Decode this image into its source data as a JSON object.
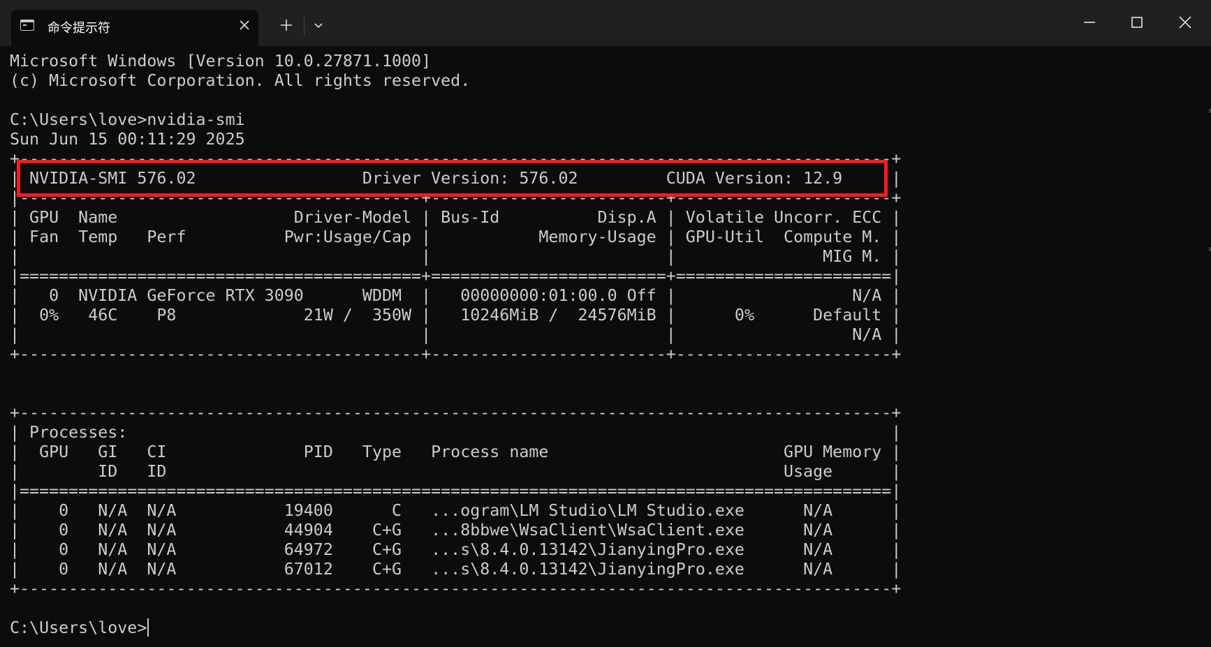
{
  "window": {
    "tab_title": "命令提示符",
    "tab_icon": "terminal-icon",
    "tab_close_icon": "close-icon",
    "new_tab_icon": "plus-icon",
    "dropdown_icon": "chevron-down-icon",
    "controls": [
      "minimize-icon",
      "maximize-icon",
      "close-icon"
    ]
  },
  "colors": {
    "background": "#0c0c0c",
    "titlebar": "#202020",
    "text": "#cccccc",
    "highlight": "#ff1a1a"
  },
  "terminal": {
    "lines": [
      "Microsoft Windows [Version 10.0.27871.1000]",
      "(c) Microsoft Corporation. All rights reserved.",
      "",
      "C:\\Users\\love>nvidia-smi",
      "Sun Jun 15 00:11:29 2025",
      "+-----------------------------------------------------------------------------------------+",
      "| NVIDIA-SMI 576.02                 Driver Version: 576.02         CUDA Version: 12.9     |",
      "|-----------------------------------------+------------------------+----------------------+",
      "| GPU  Name                  Driver-Model | Bus-Id          Disp.A | Volatile Uncorr. ECC |",
      "| Fan  Temp   Perf          Pwr:Usage/Cap |           Memory-Usage | GPU-Util  Compute M. |",
      "|                                         |                        |               MIG M. |",
      "|=========================================+========================+======================|",
      "|   0  NVIDIA GeForce RTX 3090      WDDM  |   00000000:01:00.0 Off |                  N/A |",
      "|  0%   46C    P8             21W /  350W |   10246MiB /  24576MiB |      0%      Default |",
      "|                                         |                        |                  N/A |",
      "+-----------------------------------------+------------------------+----------------------+",
      "",
      "",
      "+-----------------------------------------------------------------------------------------+",
      "| Processes:                                                                              |",
      "|  GPU   GI   CI              PID   Type   Process name                        GPU Memory |",
      "|        ID   ID                                                               Usage      |",
      "|=========================================================================================|",
      "|    0   N/A  N/A           19400      C   ...ogram\\LM Studio\\LM Studio.exe      N/A      |",
      "|    0   N/A  N/A           44904    C+G   ...8bbwe\\WsaClient\\WsaClient.exe      N/A      |",
      "|    0   N/A  N/A           64972    C+G   ...s\\8.4.0.13142\\JianyingPro.exe      N/A      |",
      "|    0   N/A  N/A           67012    C+G   ...s\\8.4.0.13142\\JianyingPro.exe      N/A      |",
      "+-----------------------------------------------------------------------------------------+",
      ""
    ],
    "prompt": "C:\\Users\\love>"
  }
}
